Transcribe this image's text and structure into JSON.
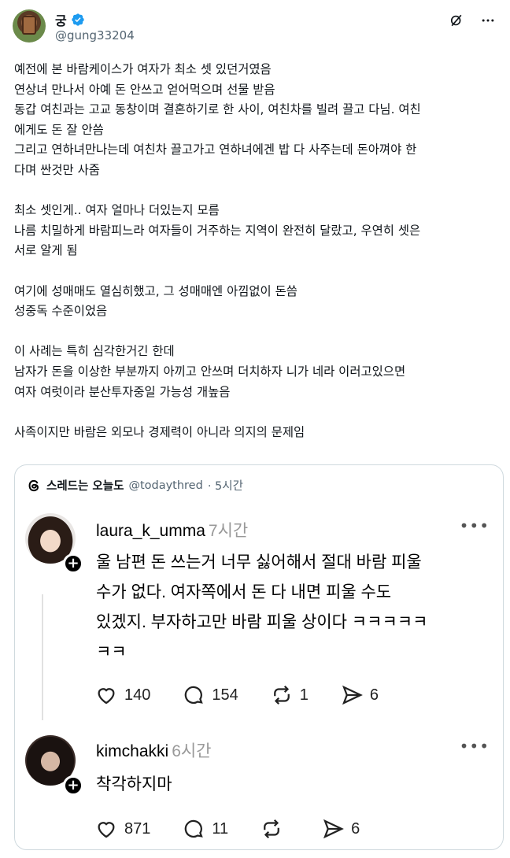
{
  "author": {
    "name": "궁",
    "handle": "@gung33204"
  },
  "tweet": {
    "paragraphs": [
      "예전에 본 바람케이스가 여자가 최소 셋 있던거였음\n연상녀 만나서 아예 돈 안쓰고 얻어먹으며 선물 받음\n동갑 여친과는 고교 동창이며 결혼하기로 한 사이, 여친차를 빌려 끌고 다님. 여친\n에게도 돈 잘 안씀\n그리고 연하녀만나는데 여친차 끌고가고 연하녀에겐 밥 다 사주는데 돈아껴야 한\n다며 싼것만 사줌",
      "최소 셋인게.. 여자 얼마나 더있는지 모름\n나름 치밀하게 바람피느라 여자들이 거주하는 지역이 완전히 달랐고, 우연히 셋은\n서로 알게 됨",
      "여기에 성매매도 열심히했고, 그 성매매엔 아낌없이 돈씀\n성중독 수준이었음",
      "이 사례는 특히 심각한거긴 한데\n남자가 돈을 이상한 부분까지 아끼고 안쓰며 더치하자 니가 네라 이러고있으면\n여자 여럿이라 분산투자중일 가능성 개높음",
      "사족이지만 바람은 외모나 경제력이 아니라 의지의 문제임"
    ]
  },
  "quote": {
    "name": "스레드는 오늘도",
    "handle": "@todaythred",
    "time": "· 5시간",
    "posts": [
      {
        "user": "laura_k_umma",
        "time": "7시간",
        "text": "울 남편 돈 쓰는거 너무 싫어해서 절대 바람 피울\n수가 없다. 여자쪽에서 돈 다 내면 피울 수도\n있겠지. 부자하고만 바람 피울 상이다 ㅋㅋㅋㅋㅋ\nㅋㅋ",
        "likes": "140",
        "comments": "154",
        "reposts": "1",
        "shares": "6"
      },
      {
        "user": "kimchakki",
        "time": "6시간",
        "text": "착각하지마",
        "likes": "871",
        "comments": "11",
        "reposts": "",
        "shares": "6"
      }
    ]
  },
  "colors": {
    "verified": "#1d9bf0",
    "secondary_text": "#536471",
    "border": "#cfd9de"
  },
  "icons": [
    "verified-badge-icon",
    "grok-icon",
    "more-icon",
    "threads-logo-icon",
    "heart-icon",
    "comment-icon",
    "repost-icon",
    "share-icon"
  ]
}
